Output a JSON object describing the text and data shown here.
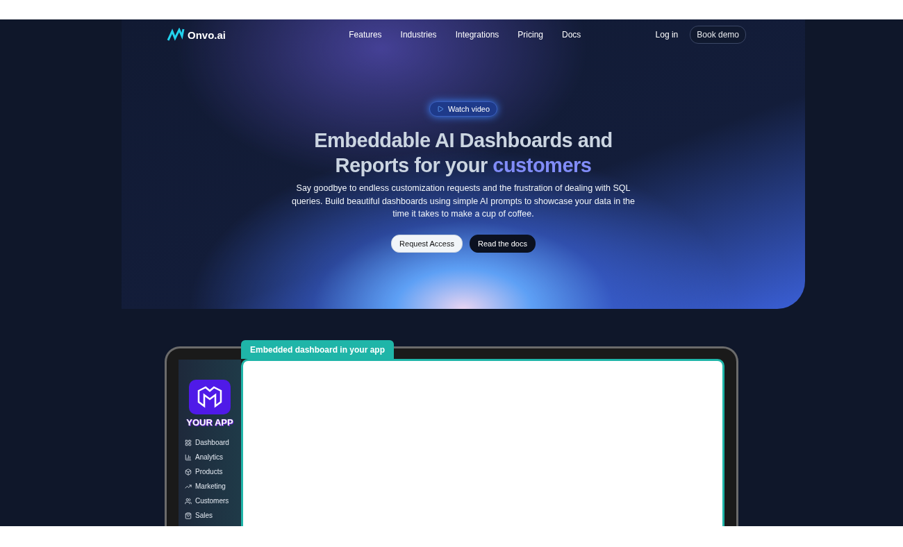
{
  "nav": {
    "logo": "Onvo.ai",
    "links": [
      "Features",
      "Industries",
      "Integrations",
      "Pricing",
      "Docs"
    ],
    "login": "Log in",
    "cta": "Book demo"
  },
  "hero": {
    "video_button": "Watch video",
    "title": "Embeddable AI Dashboards and Reports for your",
    "title_highlight": "customers",
    "subtitle": "Say goodbye to endless customization requests and the frustration of dealing with SQL queries. Build beautiful dashboards using simple AI prompts to showcase your data in the time it takes to make a cup of coffee.",
    "buttons": [
      {
        "label": "Request Access",
        "kind": "primary"
      },
      {
        "label": "Read the docs",
        "kind": "secondary"
      }
    ]
  },
  "demo": {
    "tab": "Embedded dashboard in your app",
    "app_name": "YOUR APP",
    "menu": [
      {
        "label": "Dashboard",
        "kind": "grid"
      },
      {
        "label": "Analytics",
        "kind": "chart"
      },
      {
        "label": "Products",
        "kind": "box"
      },
      {
        "label": "Marketing",
        "kind": "trend"
      },
      {
        "label": "Customers",
        "kind": "users"
      },
      {
        "label": "Sales",
        "kind": "bag"
      }
    ]
  }
}
